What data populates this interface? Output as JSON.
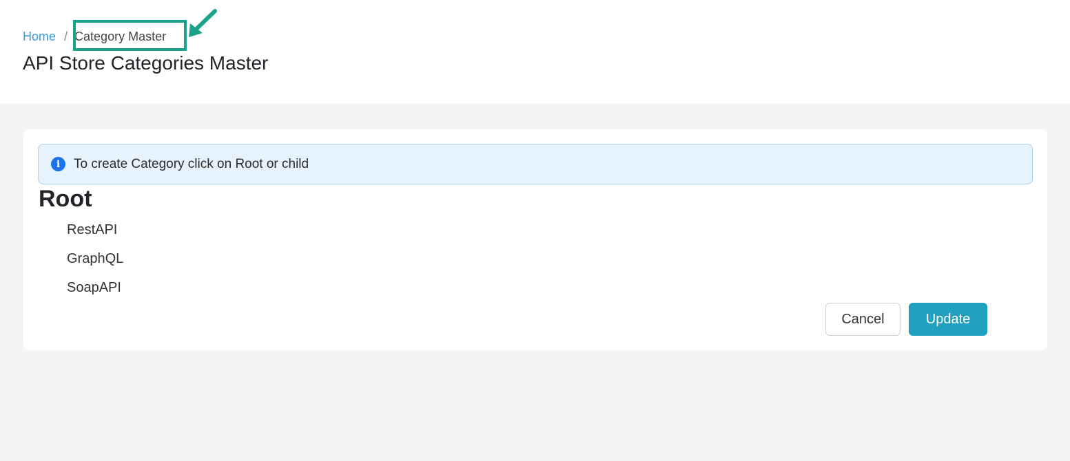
{
  "breadcrumb": {
    "home": "Home",
    "separator": "/",
    "current": "Category Master"
  },
  "page": {
    "title": "API Store Categories Master"
  },
  "alert": {
    "icon": "info-icon",
    "text": "To create Category click on Root or child"
  },
  "tree": {
    "root": "Root",
    "children": [
      "RestAPI",
      "GraphQL",
      "SoapAPI"
    ]
  },
  "actions": {
    "cancel_label": "Cancel",
    "update_label": "Update"
  },
  "colors": {
    "link": "#3a9bd9",
    "highlight": "#1aa38a",
    "primary_button": "#22a0bf",
    "alert_background": "#e6f3fd",
    "info_icon": "#1a73e8"
  }
}
